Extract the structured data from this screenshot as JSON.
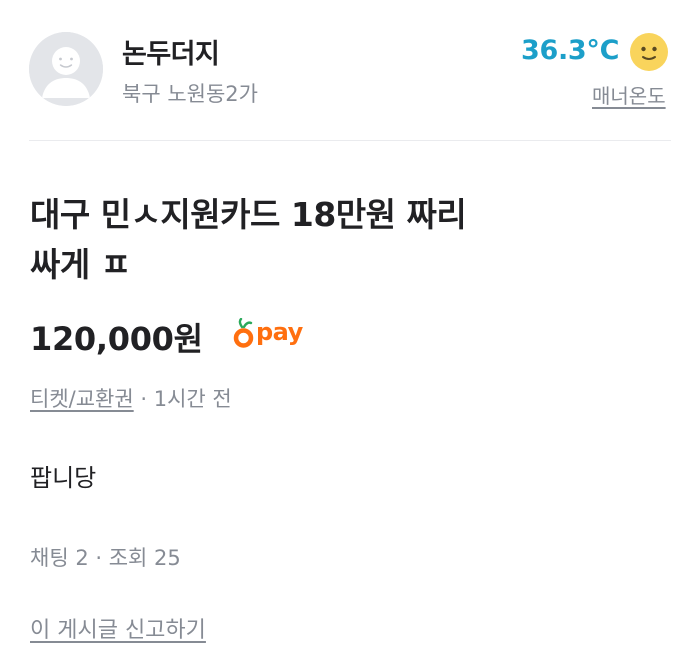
{
  "seller": {
    "nickname": "논두더지",
    "region": "북구 노원동2가",
    "temperature": "36.3°C",
    "manner_label": "매너온도"
  },
  "post": {
    "title": "대구 민ㅅ지원카드 18만원 짜리\n싸게 ㅍ",
    "price": "120,000원",
    "pay_label": "pay",
    "category": "티켓/교환권",
    "time": " · 1시간 전",
    "body": "팝니당",
    "stats": "채팅 2 · 조회 25",
    "report_label": "이 게시글 신고하기"
  },
  "colors": {
    "temperature": "#1c9fc9",
    "pay_brand": "#ff6f0f",
    "muted_text": "#868b94",
    "divider": "#eaebee"
  },
  "icons": {
    "avatar": "default-user-avatar",
    "temperature_face": "smiling-face-icon",
    "pay": "carrot-pay-logo"
  }
}
